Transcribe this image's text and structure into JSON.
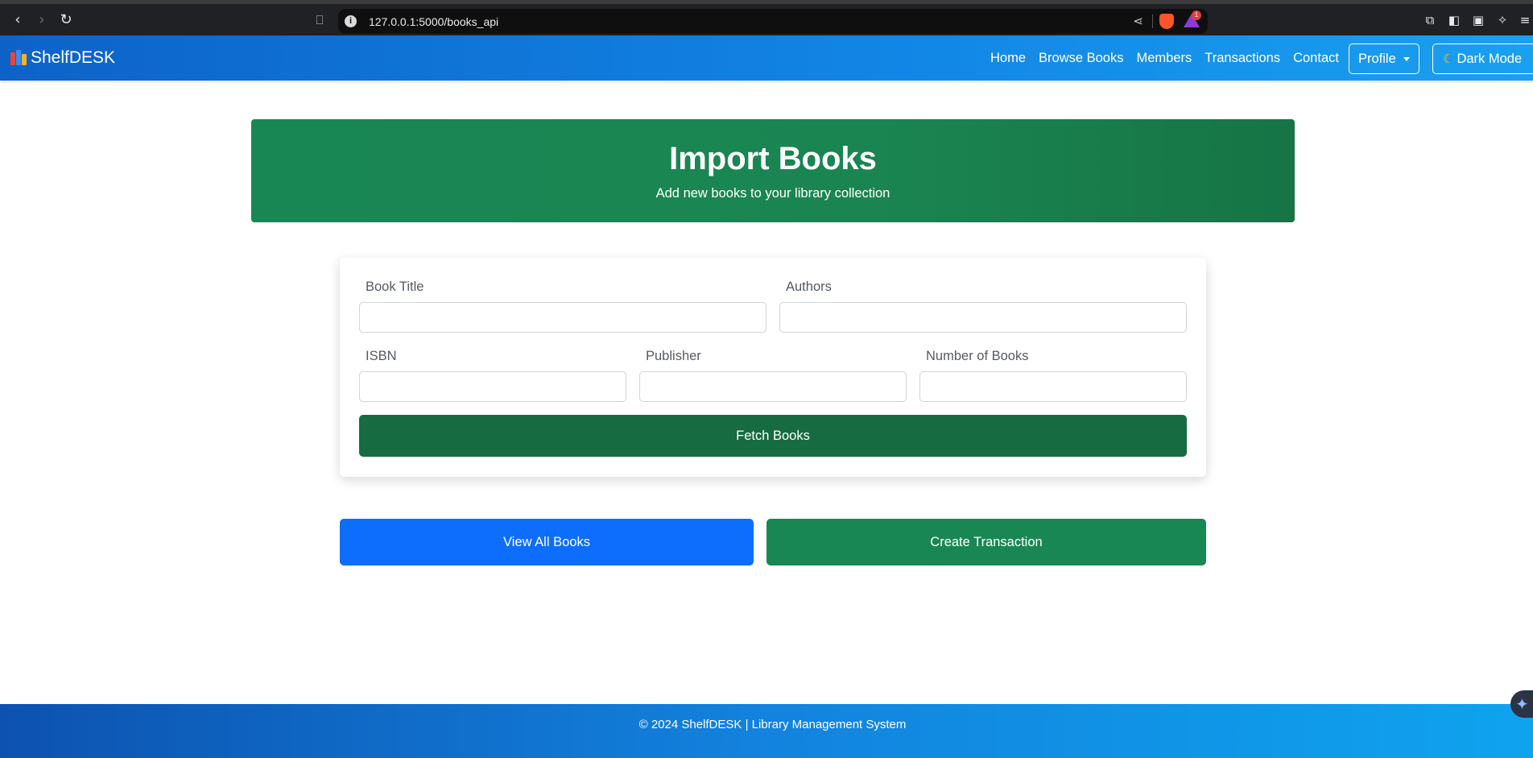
{
  "browser": {
    "url": "127.0.0.1:5000/books_api",
    "info_glyph": "i",
    "rewards_badge": "1"
  },
  "navbar": {
    "brand": "ShelfDESK",
    "links": [
      "Home",
      "Browse Books",
      "Members",
      "Transactions",
      "Contact"
    ],
    "profile_label": "Profile",
    "darkmode_label": "Dark Mode",
    "colors": {
      "start": "#0d62c8",
      "end": "#1aa0f0"
    }
  },
  "hero": {
    "title": "Import Books",
    "subtitle": "Add new books to your library collection",
    "color": "#198754"
  },
  "form": {
    "book_title_label": "Book Title",
    "authors_label": "Authors",
    "isbn_label": "ISBN",
    "publisher_label": "Publisher",
    "number_label": "Number of Books",
    "book_title_value": "",
    "authors_value": "",
    "isbn_value": "",
    "publisher_value": "",
    "number_value": "",
    "fetch_label": "Fetch Books"
  },
  "actions": {
    "view_all_label": "View All Books",
    "create_transaction_label": "Create Transaction"
  },
  "footer": {
    "text": "© 2024 ShelfDESK | Library Management System"
  }
}
